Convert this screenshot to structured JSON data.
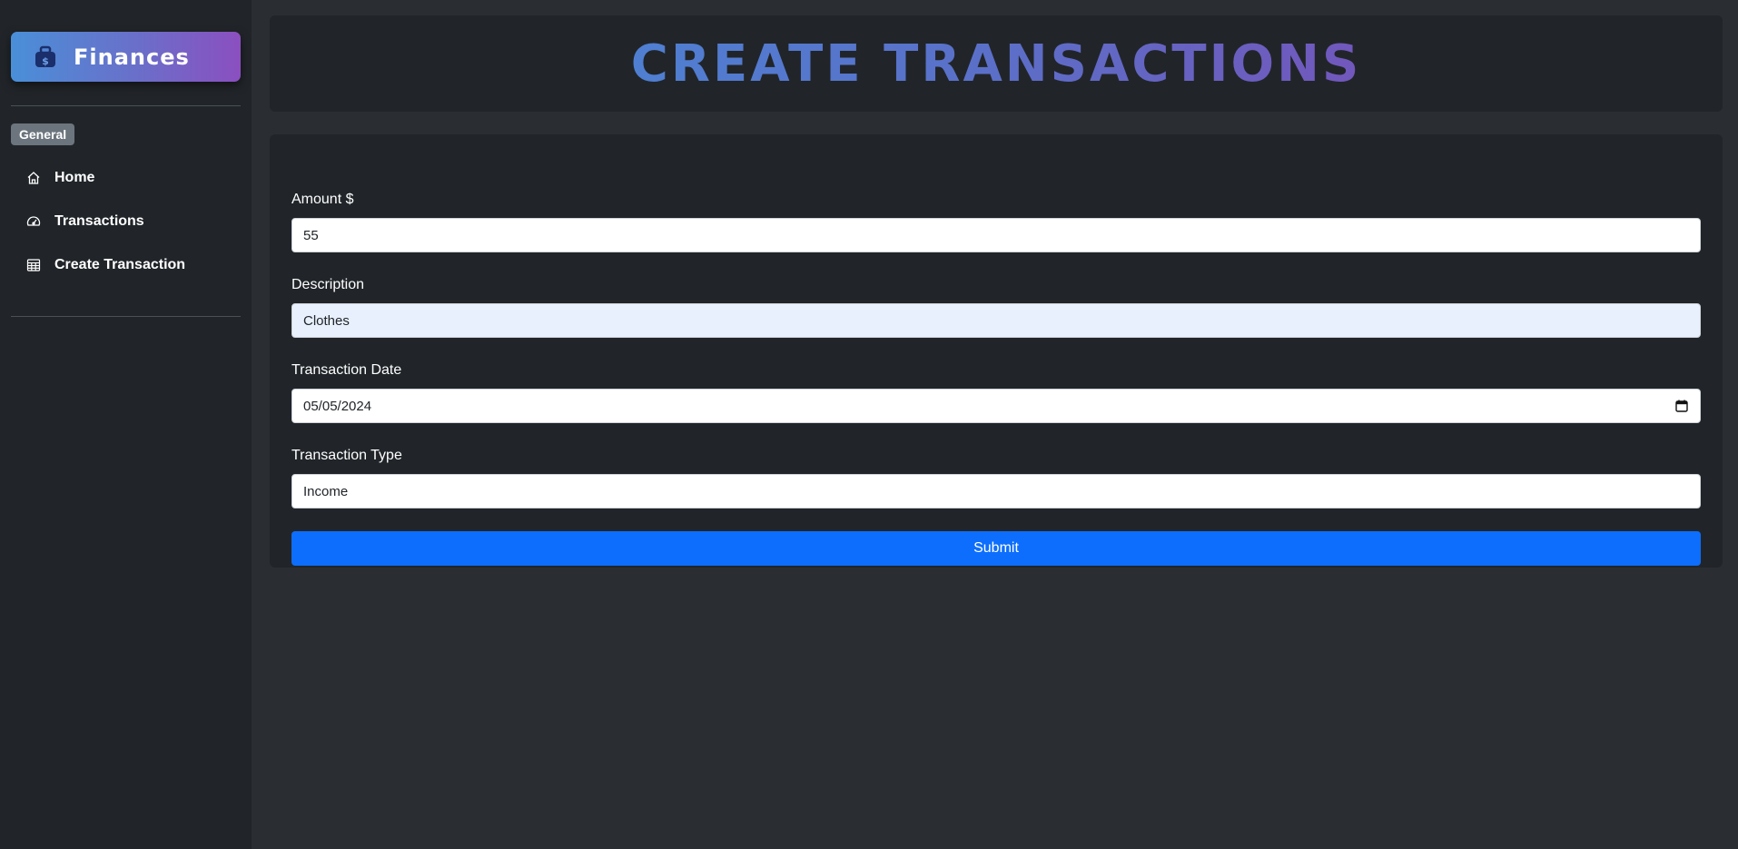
{
  "sidebar": {
    "brand": {
      "label": "Finances",
      "icon": "money-bag-icon"
    },
    "section_label": "General",
    "items": [
      {
        "label": "Home",
        "icon": "house-icon"
      },
      {
        "label": "Transactions",
        "icon": "speedometer-icon"
      },
      {
        "label": "Create Transaction",
        "icon": "table-icon"
      }
    ]
  },
  "header": {
    "title": "CREATE TRANSACTIONS"
  },
  "form": {
    "amount": {
      "label": "Amount $",
      "value": "55"
    },
    "description": {
      "label": "Description",
      "value": "Clothes"
    },
    "date": {
      "label": "Transaction Date",
      "value": "05/05/2024"
    },
    "type": {
      "label": "Transaction Type",
      "value": "Income"
    },
    "submit_label": "Submit"
  },
  "colors": {
    "sidebar_bg": "#212529",
    "page_bg": "#2a2e33",
    "accent": "#0d6efd",
    "brand_gradient_start": "#4a8fd8",
    "brand_gradient_end": "#8b4fc0"
  }
}
